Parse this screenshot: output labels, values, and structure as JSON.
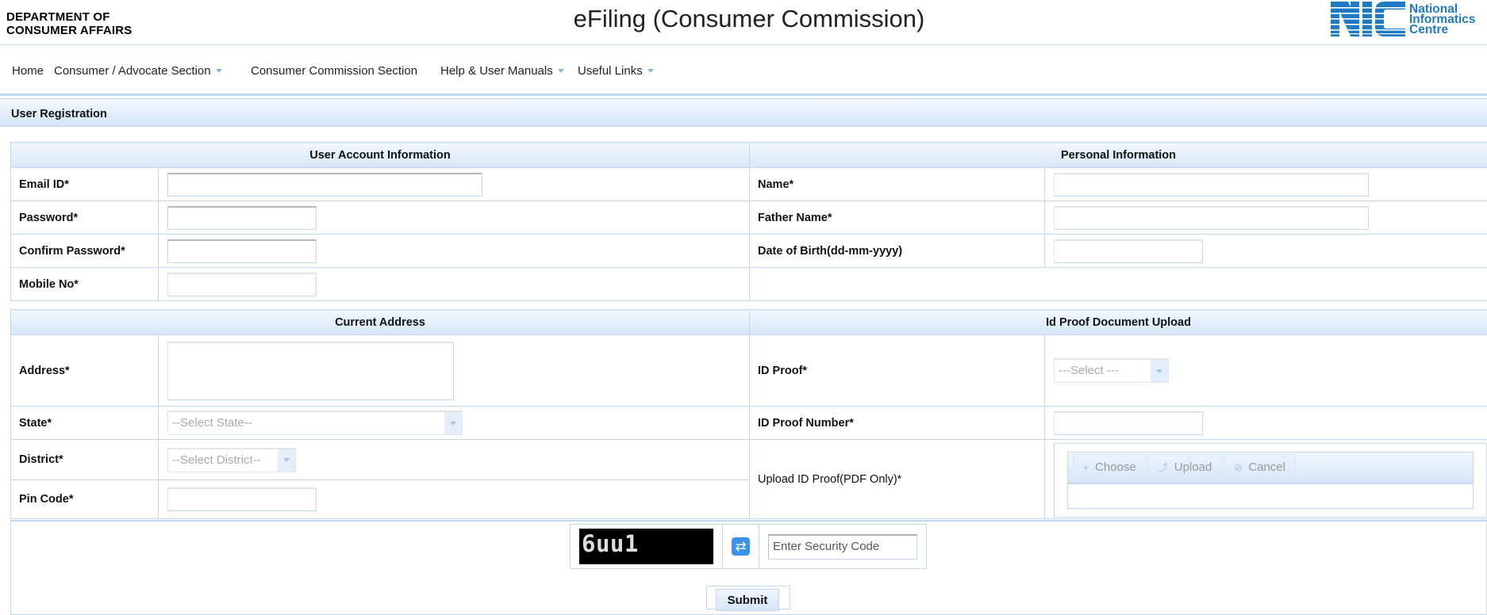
{
  "header": {
    "department_line1": "DEPARTMENT OF",
    "department_line2": "CONSUMER AFFAIRS",
    "title": "eFiling (Consumer Commission)",
    "logo": {
      "mark": "NIC",
      "line1": "National",
      "line2": "Informatics",
      "line3": "Centre",
      "color": "#1f7ac5"
    }
  },
  "nav": {
    "items": [
      {
        "label": "Home",
        "dropdown": false
      },
      {
        "label": "Consumer / Advocate Section",
        "dropdown": true
      },
      {
        "label": "Consumer Commission Section",
        "dropdown": false
      },
      {
        "label": "Help & User Manuals",
        "dropdown": true
      },
      {
        "label": "Useful Links",
        "dropdown": true
      }
    ]
  },
  "page": {
    "section_title": "User Registration"
  },
  "account": {
    "heading": "User Account Information",
    "fields": [
      {
        "label": "Email ID*",
        "value": ""
      },
      {
        "label": "Password*",
        "value": ""
      },
      {
        "label": "Confirm Password*",
        "value": ""
      },
      {
        "label": "Mobile No*",
        "value": ""
      }
    ]
  },
  "personal": {
    "heading": "Personal Information",
    "fields": [
      {
        "label": "Name*",
        "value": ""
      },
      {
        "label": "Father Name*",
        "value": ""
      },
      {
        "label": "Date of Birth(dd-mm-yyyy)",
        "value": ""
      }
    ]
  },
  "address": {
    "heading": "Current Address",
    "address_label": "Address*",
    "address_value": "",
    "state_label": "State*",
    "state_selected": "--Select State--",
    "district_label": "District*",
    "district_selected": "--Select District--",
    "pincode_label": "Pin Code*",
    "pincode_value": ""
  },
  "idproof": {
    "heading": "Id Proof Document Upload",
    "proof_label": "ID Proof*",
    "proof_selected": "---Select ---",
    "number_label": "ID Proof Number*",
    "number_value": "",
    "upload_label": "Upload ID Proof(PDF Only)*",
    "buttons": {
      "choose": "Choose",
      "upload": "Upload",
      "cancel": "Cancel"
    },
    "icons": {
      "choose": "+",
      "upload": "⤴",
      "cancel": "⊘"
    }
  },
  "captcha": {
    "code": "6uu1",
    "refresh_icon": "⇄",
    "placeholder": "Enter Security Code"
  },
  "actions": {
    "submit": "Submit"
  },
  "colors": {
    "border": "#c3d9f1",
    "header_gradient_top": "#f2f7fe",
    "header_gradient_bottom": "#d6e6f8",
    "refresh_button": "#3b93e8"
  }
}
